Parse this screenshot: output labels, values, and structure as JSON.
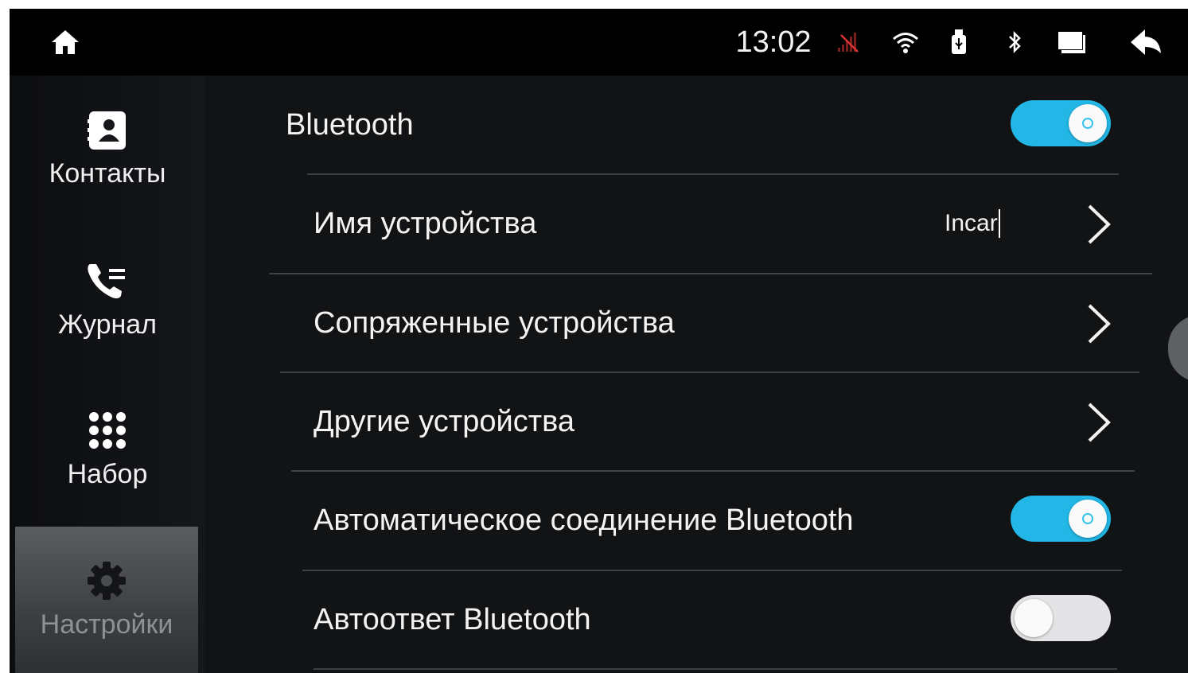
{
  "status_bar": {
    "time": "13:02",
    "icons": [
      "home-icon",
      "no-signal-icon",
      "wifi-icon",
      "usb-icon",
      "bluetooth-icon",
      "screen-icon",
      "back-icon"
    ]
  },
  "sidebar": {
    "items": [
      {
        "label": "Контакты",
        "icon": "contacts-icon"
      },
      {
        "label": "Журнал",
        "icon": "call-log-icon"
      },
      {
        "label": "Набор",
        "icon": "dialpad-icon"
      },
      {
        "label": "Настройки",
        "icon": "gear-icon",
        "active": true
      }
    ]
  },
  "settings": {
    "bluetooth": {
      "label": "Bluetooth",
      "enabled": true
    },
    "device_name": {
      "label": "Имя устройства",
      "value": "Incar"
    },
    "paired_devices": {
      "label": "Сопряженные устройства"
    },
    "other_devices": {
      "label": "Другие устройства"
    },
    "auto_connect": {
      "label": "Автоматическое соединение Bluetooth",
      "enabled": true
    },
    "auto_answer": {
      "label": "Автоответ Bluetooth",
      "enabled": false
    }
  },
  "colors": {
    "accent": "#22b7e6",
    "background": "#121315",
    "status_bar": "#000000",
    "no_signal": "#c0392b"
  }
}
